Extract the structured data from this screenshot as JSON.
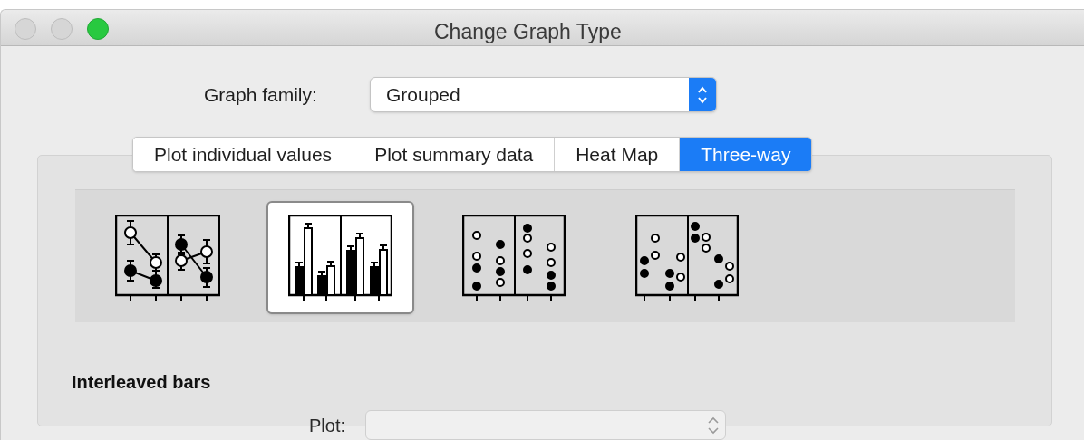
{
  "window": {
    "title": "Change Graph Type"
  },
  "graph_family": {
    "label": "Graph family:",
    "value": "Grouped"
  },
  "tabs": [
    {
      "label": "Plot individual values",
      "selected": false
    },
    {
      "label": "Plot summary data",
      "selected": false
    },
    {
      "label": "Heat Map",
      "selected": false
    },
    {
      "label": "Three-way",
      "selected": true
    }
  ],
  "graph_types": [
    {
      "kind": "line",
      "selected": false
    },
    {
      "kind": "bar",
      "selected": true
    },
    {
      "kind": "dots",
      "selected": false
    },
    {
      "kind": "scatter",
      "selected": false
    }
  ],
  "section_title": "Interleaved bars",
  "plot": {
    "label": "Plot:",
    "disabled": true
  }
}
